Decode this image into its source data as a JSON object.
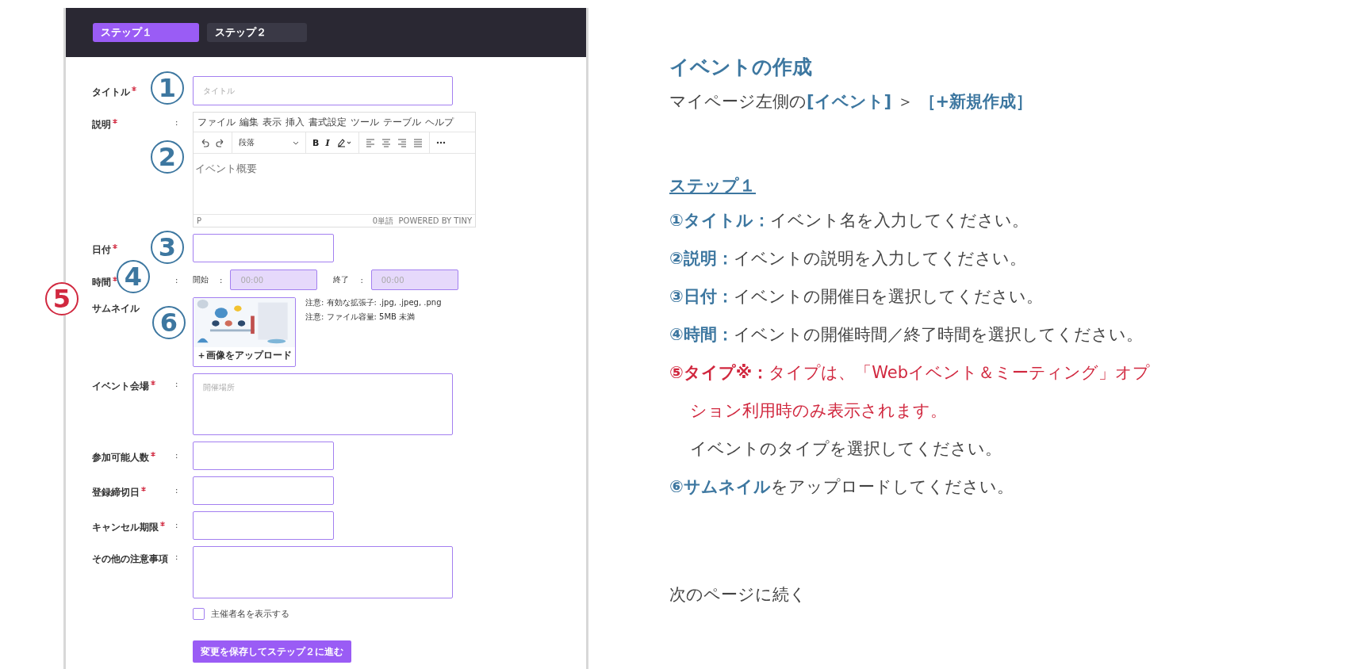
{
  "tabs": [
    {
      "label": "ステップ１",
      "selected": true
    },
    {
      "label": "ステップ２",
      "selected": false
    }
  ],
  "form": {
    "fields": [
      {
        "kind": "text",
        "label": "タイトル",
        "required": true,
        "placeholder": "タイトル"
      },
      {
        "kind": "editor",
        "label": "説明",
        "required": true,
        "colon": ":",
        "menu": [
          "ファイル",
          "編集",
          "表示",
          "挿入",
          "書式設定",
          "ツール",
          "テーブル",
          "ヘルプ"
        ],
        "block_format": "段落",
        "format_buttons": [
          "B",
          "I"
        ],
        "placeholder": "イベント概要",
        "path": "P",
        "word_count": "0単語",
        "branding": "POWERED BY TINY"
      },
      {
        "kind": "short",
        "label": "日付",
        "required": true
      },
      {
        "kind": "time",
        "label": "時間",
        "required": true,
        "colon": ":",
        "start_label": "開始",
        "start_colon": ":",
        "start_placeholder": "00:00",
        "end_label": "終了",
        "end_colon": ":",
        "end_placeholder": "00:00"
      },
      {
        "kind": "thumbnail",
        "label": "サムネイル",
        "required": false,
        "upload_label": "＋画像をアップロード",
        "notes": [
          "注意: 有効な拡張子: .jpg, .jpeg, .png",
          "注意: ファイル容量: 5MB 未満"
        ]
      },
      {
        "kind": "textarea",
        "label": "イベント会場",
        "required": true,
        "colon": ":",
        "placeholder": "開催場所"
      },
      {
        "kind": "short",
        "label": "参加可能人数",
        "required": true,
        "colon": ":"
      },
      {
        "kind": "short",
        "label": "登録締切日",
        "required": true,
        "colon": ":"
      },
      {
        "kind": "short",
        "label": "キャンセル期限",
        "required": true,
        "colon": ":"
      },
      {
        "kind": "notes",
        "label": "その他の注意事項",
        "required": false,
        "colon": ":"
      }
    ],
    "checkbox": {
      "label": "主催者名を表示する",
      "checked": false
    },
    "submit_button": "変更を保存してステップ２に進む"
  },
  "markers": [
    {
      "label": "1",
      "color": "#3d77a0"
    },
    {
      "label": "2",
      "color": "#3d77a0"
    },
    {
      "label": "3",
      "color": "#3d77a0"
    },
    {
      "label": "4",
      "color": "#3d77a0"
    },
    {
      "label": "5",
      "color": "#d1283f"
    },
    {
      "label": "6",
      "color": "#3d77a0"
    }
  ],
  "guide": {
    "title": "イベントの作成",
    "path": "マイページ左側の**[イベント]** ＞ **［+新規作成］**",
    "step_heading": "ステップ１",
    "lines": [
      {
        "text": "**①タイトル：**イベント名を入力してください。",
        "warning": false,
        "indent": false
      },
      {
        "text": "**②説明：**イベントの説明を入力してください。",
        "warning": false,
        "indent": false
      },
      {
        "text": "**③日付：**イベントの開催日を選択してください。",
        "warning": false,
        "indent": false
      },
      {
        "text": "**④時間：**イベントの開催時間／終了時間を選択してください。",
        "warning": false,
        "indent": false
      },
      {
        "text": "**⑤タイプ※：**タイプは、「Webイベント＆ミーティング」オプ",
        "warning": true,
        "indent": false
      },
      {
        "text": "ション利用時のみ表示されます。",
        "warning": true,
        "indent": true
      },
      {
        "text": "イベントのタイプを選択してください。",
        "warning": false,
        "indent": true
      },
      {
        "text": "**⑥サムネイル**をアップロードしてください。",
        "warning": false,
        "indent": false
      }
    ],
    "footer": "次のページに続く"
  }
}
